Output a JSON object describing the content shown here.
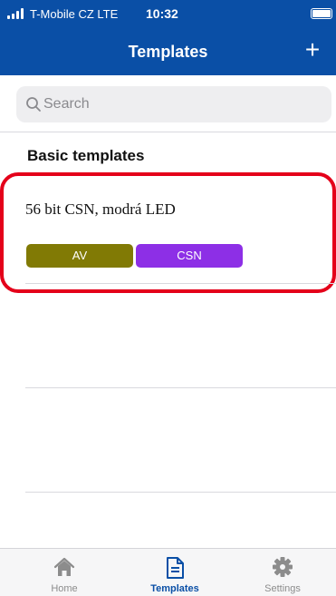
{
  "status_bar": {
    "carrier": "T-Mobile CZ  LTE",
    "time": "10:32"
  },
  "nav": {
    "title": "Templates",
    "add_label": "+"
  },
  "search": {
    "placeholder": "Search"
  },
  "section": {
    "title": "Basic templates"
  },
  "templates": [
    {
      "name": "56 bit CSN, modrá LED",
      "tags": [
        {
          "label": "AV",
          "color": "#817a05"
        },
        {
          "label": "CSN",
          "color": "#8d2fe6"
        }
      ]
    }
  ],
  "tab_bar": {
    "items": [
      {
        "label": "Home",
        "icon": "home-icon",
        "active": false
      },
      {
        "label": "Templates",
        "icon": "document-icon",
        "active": true
      },
      {
        "label": "Settings",
        "icon": "gear-icon",
        "active": false
      }
    ]
  },
  "colors": {
    "header": "#0a4fa6",
    "highlight_border": "#e4001a",
    "active_tab": "#0a4fa6",
    "inactive_tab": "#8c8c8c"
  }
}
